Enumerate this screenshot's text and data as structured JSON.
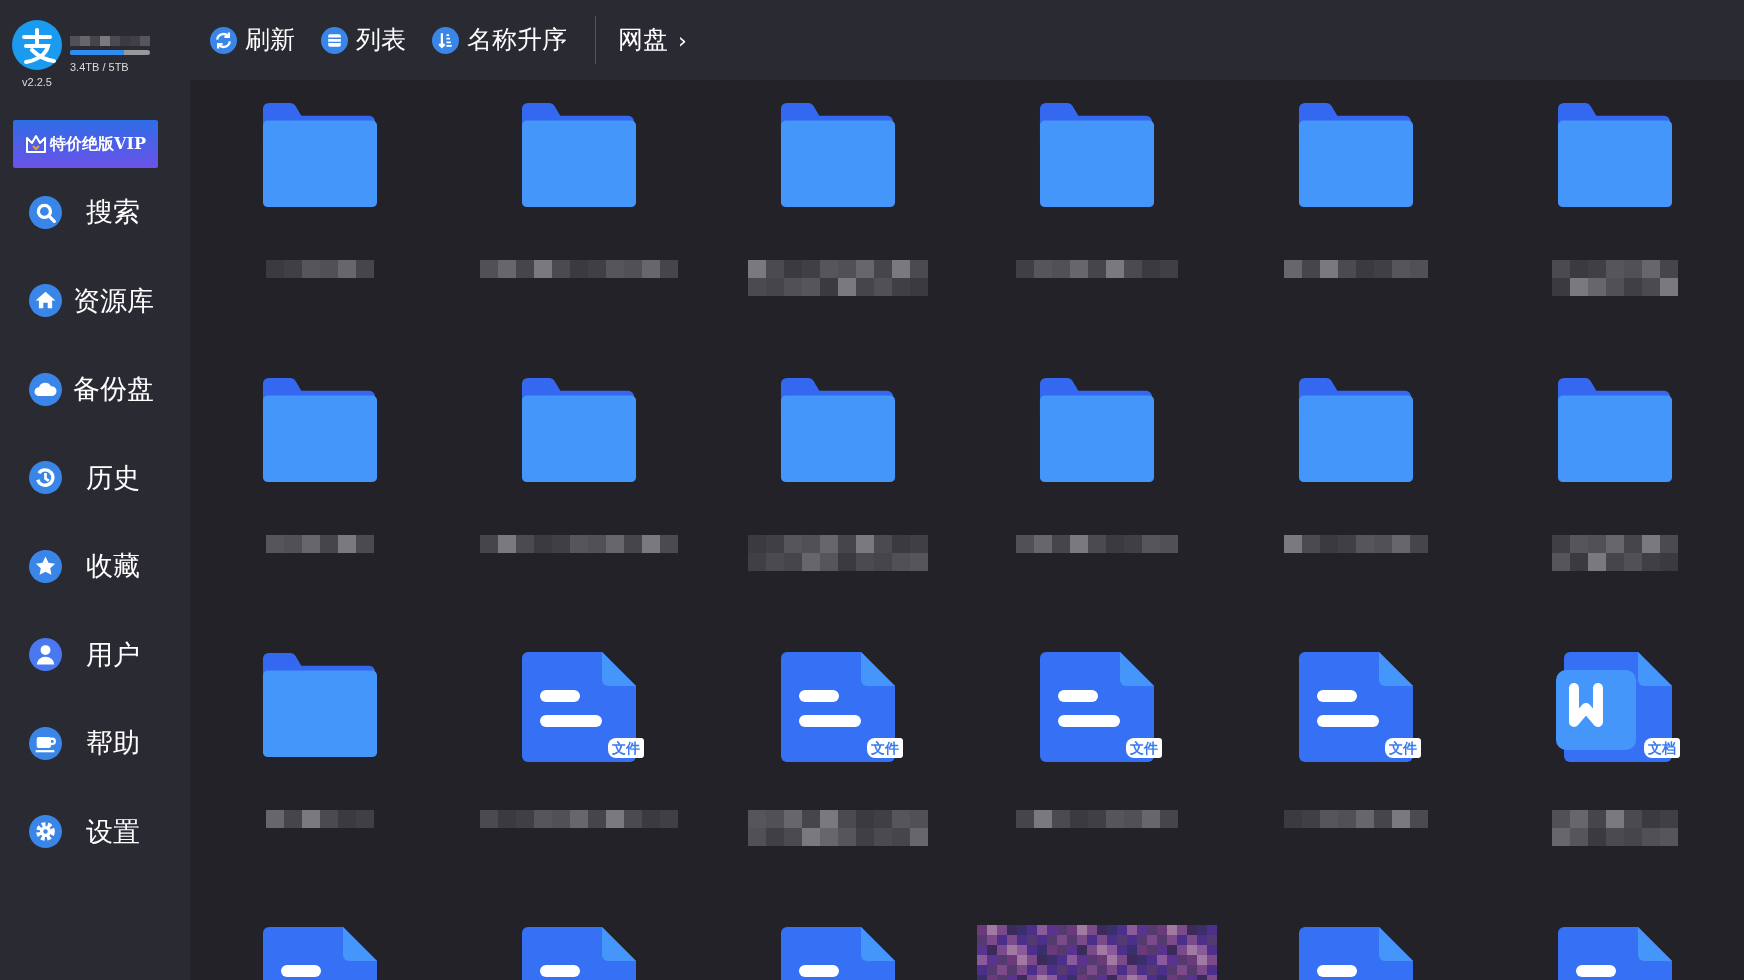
{
  "app": {
    "version": "v2.2.5",
    "storage": {
      "text": "3.4TB / 5TB",
      "level": 0.68
    },
    "vip_button": "特价绝版VIP"
  },
  "sidebar": {
    "items": [
      {
        "label": "搜索"
      },
      {
        "label": "资源库"
      },
      {
        "label": "备份盘"
      },
      {
        "label": "历史"
      },
      {
        "label": "收藏"
      },
      {
        "label": "用户"
      },
      {
        "label": "帮助"
      },
      {
        "label": "设置"
      }
    ]
  },
  "toolbar": [
    {
      "label": "刷新"
    },
    {
      "label": "列表"
    },
    {
      "label": "名称升序"
    }
  ],
  "breadcrumb": {
    "label": "网盘",
    "arrow": "›"
  },
  "files": [
    {
      "kind": "folder"
    },
    {
      "kind": "folder"
    },
    {
      "kind": "folder"
    },
    {
      "kind": "folder"
    },
    {
      "kind": "folder"
    },
    {
      "kind": "folder"
    },
    {
      "kind": "folder"
    },
    {
      "kind": "folder"
    },
    {
      "kind": "folder"
    },
    {
      "kind": "folder"
    },
    {
      "kind": "folder"
    },
    {
      "kind": "folder"
    },
    {
      "kind": "folder"
    },
    {
      "kind": "file",
      "badge": "文件"
    },
    {
      "kind": "file",
      "badge": "文件"
    },
    {
      "kind": "file",
      "badge": "文件"
    },
    {
      "kind": "file",
      "badge": "文件"
    },
    {
      "kind": "word",
      "badge": "文档"
    },
    {
      "kind": "file"
    },
    {
      "kind": "file"
    },
    {
      "kind": "file"
    },
    {
      "kind": "picture"
    },
    {
      "kind": "file"
    },
    {
      "kind": "file"
    }
  ]
}
